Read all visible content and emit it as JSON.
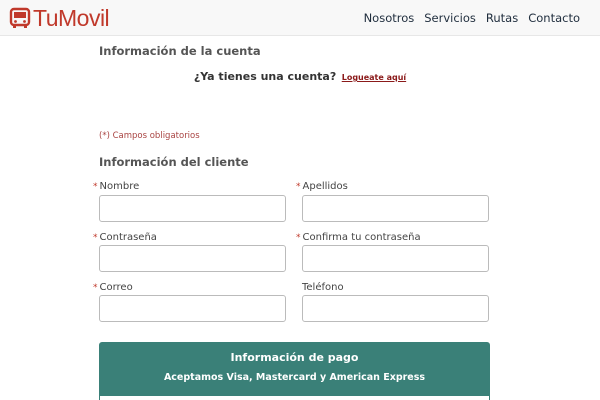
{
  "brand": {
    "name": "TuMovil",
    "color": "#c0392b"
  },
  "nav": {
    "items": [
      {
        "label": "Nosotros"
      },
      {
        "label": "Servicios"
      },
      {
        "label": "Rutas"
      },
      {
        "label": "Contacto"
      }
    ]
  },
  "account": {
    "title": "Información de la cuenta",
    "login_question": "¿Ya tienes una cuenta?",
    "login_link": "Logueate aquí"
  },
  "required_note": "(*) Campos obligatorios",
  "client": {
    "title": "Información del cliente",
    "required_marker": "*",
    "fields": {
      "nombre": {
        "label": "Nombre",
        "required": true,
        "value": ""
      },
      "apellidos": {
        "label": "Apellidos",
        "required": true,
        "value": ""
      },
      "contrasena": {
        "label": "Contraseña",
        "required": true,
        "value": ""
      },
      "confirma": {
        "label": "Confirma tu contraseña",
        "required": true,
        "value": ""
      },
      "correo": {
        "label": "Correo",
        "required": true,
        "value": ""
      },
      "telefono": {
        "label": "Teléfono",
        "required": false,
        "value": ""
      }
    }
  },
  "payment": {
    "title": "Información de pago",
    "subtitle": "Aceptamos Visa, Mastercard y American Express",
    "color": "#3a8078"
  }
}
